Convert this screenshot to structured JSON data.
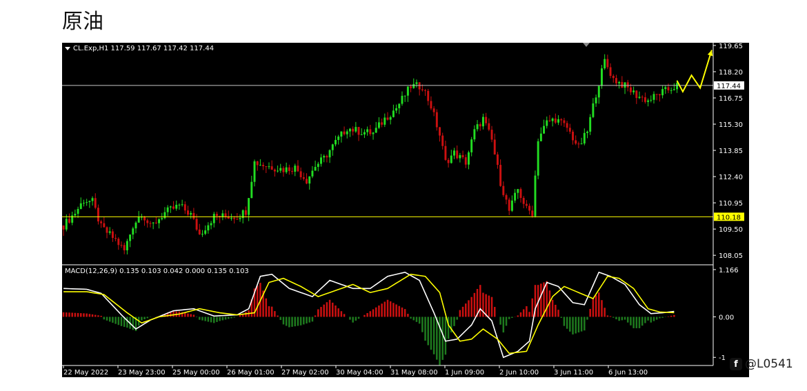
{
  "page": {
    "title": "原油"
  },
  "watermark": {
    "text": "@L0541"
  },
  "chart_data": [
    {
      "type": "candlestick",
      "title": "CL.Exp,H1  117.59 117.67 117.42 117.44",
      "symbol": "CL.Exp",
      "timeframe": "H1",
      "ohlc_last": {
        "open": 117.59,
        "high": 117.67,
        "low": 117.42,
        "close": 117.44
      },
      "ylim": [
        107.6,
        119.8
      ],
      "y_ticks": [
        "119.65",
        "118.20",
        "116.75",
        "115.30",
        "113.85",
        "112.40",
        "110.95",
        "109.50",
        "108.05"
      ],
      "x_ticks": [
        "22 May 2022",
        "23 May 23:00",
        "25 May 00:00",
        "26 May 01:00",
        "27 May 02:00",
        "30 May 04:00",
        "31 May 08:00",
        "1 Jun 09:00",
        "2 Jun 10:00",
        "3 Jun 11:00",
        "6 Jun 13:00"
      ],
      "price_path": [
        [
          0,
          109.7
        ],
        [
          4,
          110.4
        ],
        [
          7,
          111.1
        ],
        [
          10,
          111.0
        ],
        [
          13,
          109.6
        ],
        [
          18,
          108.9
        ],
        [
          21,
          108.3
        ],
        [
          24,
          109.7
        ],
        [
          27,
          110.4
        ],
        [
          30,
          109.6
        ],
        [
          35,
          110.4
        ],
        [
          40,
          110.8
        ],
        [
          44,
          110.3
        ],
        [
          47,
          109.2
        ],
        [
          52,
          110.2
        ],
        [
          60,
          110.2
        ],
        [
          63,
          110.5
        ],
        [
          66,
          113.2
        ],
        [
          70,
          113.0
        ],
        [
          76,
          112.8
        ],
        [
          80,
          112.9
        ],
        [
          84,
          112.2
        ],
        [
          87,
          113.0
        ],
        [
          90,
          113.4
        ],
        [
          94,
          114.3
        ],
        [
          98,
          115.1
        ],
        [
          102,
          114.9
        ],
        [
          107,
          114.8
        ],
        [
          111,
          115.6
        ],
        [
          115,
          116.2
        ],
        [
          120,
          117.4
        ],
        [
          124,
          117.4
        ],
        [
          127,
          116.3
        ],
        [
          130,
          114.7
        ],
        [
          132,
          113.2
        ],
        [
          135,
          113.7
        ],
        [
          139,
          113.2
        ],
        [
          142,
          114.9
        ],
        [
          145,
          115.6
        ],
        [
          148,
          114.4
        ],
        [
          151,
          112.1
        ],
        [
          154,
          110.5
        ],
        [
          157,
          111.7
        ],
        [
          160,
          110.6
        ],
        [
          162,
          110.4
        ],
        [
          164,
          114.5
        ],
        [
          167,
          115.4
        ],
        [
          170,
          115.6
        ],
        [
          174,
          115.1
        ],
        [
          178,
          114.0
        ],
        [
          181,
          114.9
        ],
        [
          184,
          117.0
        ],
        [
          187,
          118.8
        ],
        [
          190,
          117.8
        ],
        [
          194,
          117.4
        ],
        [
          198,
          116.9
        ],
        [
          202,
          116.6
        ],
        [
          206,
          117.0
        ],
        [
          209,
          117.2
        ],
        [
          212,
          117.44
        ]
      ],
      "horizontal_lines": [
        {
          "value": 117.44,
          "label": "117.44",
          "color": "#c8c8c8",
          "label_bg": "#ffffff",
          "label_color": "#000000"
        },
        {
          "value": 110.18,
          "label": "110.18",
          "color": "#ffff00",
          "label_bg": "#ffff00",
          "label_color": "#000000"
        }
      ],
      "projection_arrow": {
        "color": "#ffff00",
        "points": [
          [
            212,
            117.7
          ],
          [
            214,
            117.1
          ],
          [
            217,
            118.0
          ],
          [
            220,
            117.3
          ],
          [
            224,
            119.4
          ]
        ]
      },
      "bull_color": "#22dd22",
      "bear_color": "#cc1010"
    },
    {
      "type": "line",
      "title": "MACD(12,26,9) 0.135 0.103 0.042 0.000 0.135 0.103",
      "ylim": [
        -1.2,
        1.25
      ],
      "y_ticks": [
        "1.166",
        "0.00",
        "-1"
      ],
      "series": [
        {
          "name": "macd",
          "color": "#ffffff",
          "points": [
            [
              0,
              0.7
            ],
            [
              8,
              0.68
            ],
            [
              13,
              0.58
            ],
            [
              20,
              0.05
            ],
            [
              25,
              -0.3
            ],
            [
              30,
              -0.08
            ],
            [
              38,
              0.15
            ],
            [
              45,
              0.2
            ],
            [
              52,
              0.02
            ],
            [
              60,
              0.05
            ],
            [
              64,
              0.2
            ],
            [
              68,
              1.0
            ],
            [
              72,
              1.05
            ],
            [
              78,
              0.7
            ],
            [
              86,
              0.5
            ],
            [
              92,
              0.9
            ],
            [
              100,
              0.7
            ],
            [
              106,
              0.7
            ],
            [
              112,
              1.0
            ],
            [
              118,
              1.1
            ],
            [
              123,
              0.9
            ],
            [
              128,
              0.1
            ],
            [
              132,
              -0.6
            ],
            [
              136,
              -0.55
            ],
            [
              141,
              -0.2
            ],
            [
              144,
              0.2
            ],
            [
              148,
              -0.1
            ],
            [
              152,
              -1.0
            ],
            [
              157,
              -0.85
            ],
            [
              161,
              -0.6
            ],
            [
              163,
              0.2
            ],
            [
              167,
              0.85
            ],
            [
              171,
              0.75
            ],
            [
              176,
              0.35
            ],
            [
              180,
              0.3
            ],
            [
              185,
              1.1
            ],
            [
              189,
              1.0
            ],
            [
              194,
              0.8
            ],
            [
              199,
              0.3
            ],
            [
              203,
              0.08
            ],
            [
              207,
              0.1
            ],
            [
              211,
              0.135
            ]
          ]
        },
        {
          "name": "signal",
          "color": "#ffff00",
          "points": [
            [
              0,
              0.62
            ],
            [
              8,
              0.62
            ],
            [
              14,
              0.55
            ],
            [
              22,
              0.1
            ],
            [
              27,
              -0.15
            ],
            [
              33,
              0.0
            ],
            [
              40,
              0.07
            ],
            [
              47,
              0.2
            ],
            [
              54,
              0.1
            ],
            [
              60,
              0.05
            ],
            [
              66,
              0.1
            ],
            [
              71,
              0.85
            ],
            [
              76,
              0.95
            ],
            [
              82,
              0.75
            ],
            [
              88,
              0.5
            ],
            [
              94,
              0.65
            ],
            [
              100,
              0.8
            ],
            [
              106,
              0.6
            ],
            [
              112,
              0.7
            ],
            [
              120,
              1.05
            ],
            [
              125,
              1.0
            ],
            [
              130,
              0.6
            ],
            [
              133,
              -0.2
            ],
            [
              137,
              -0.6
            ],
            [
              141,
              -0.55
            ],
            [
              145,
              -0.3
            ],
            [
              150,
              -0.55
            ],
            [
              154,
              -0.9
            ],
            [
              160,
              -0.85
            ],
            [
              164,
              -0.2
            ],
            [
              169,
              0.5
            ],
            [
              173,
              0.75
            ],
            [
              178,
              0.6
            ],
            [
              183,
              0.45
            ],
            [
              188,
              1.0
            ],
            [
              192,
              0.95
            ],
            [
              197,
              0.7
            ],
            [
              202,
              0.2
            ],
            [
              206,
              0.12
            ],
            [
              211,
              0.103
            ]
          ]
        }
      ],
      "histogram": {
        "positive_color": "#cc1010",
        "negative_color": "#1e7a1e"
      }
    }
  ]
}
